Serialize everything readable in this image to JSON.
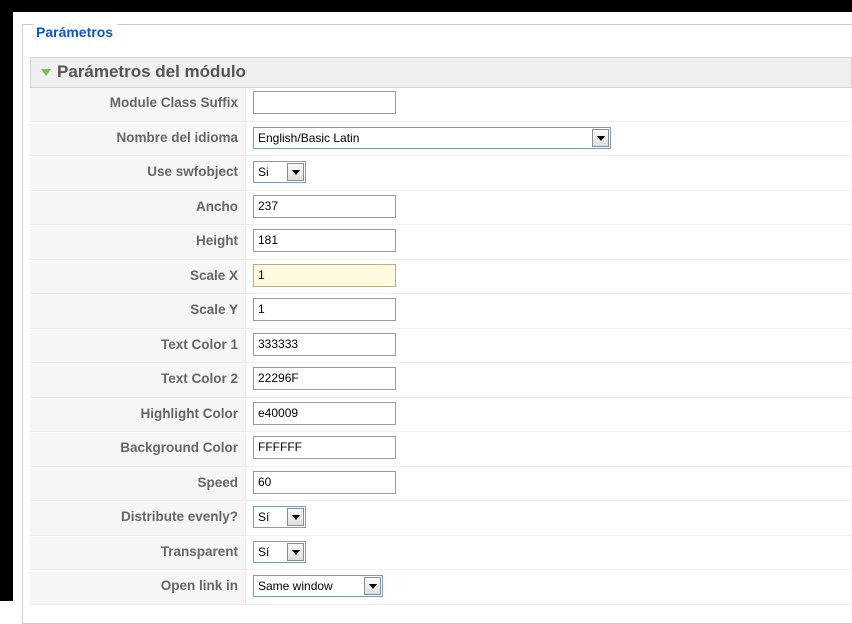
{
  "fieldset": {
    "legend": "Parámetros"
  },
  "panel": {
    "title": "Parámetros del módulo",
    "arrow_color": "#76c043"
  },
  "colors": {
    "legend": "#0b55c4",
    "label": "#666666",
    "focused_bg": "#fffadf"
  },
  "rows": [
    {
      "label": "Module Class Suffix",
      "value": "",
      "kind": "text"
    },
    {
      "label": "Nombre del idioma",
      "value": "English/Basic Latin",
      "kind": "select"
    },
    {
      "label": "Use swfobject",
      "value": "Si",
      "kind": "select"
    },
    {
      "label": "Ancho",
      "value": "237",
      "kind": "text"
    },
    {
      "label": "Height",
      "value": "181",
      "kind": "text"
    },
    {
      "label": "Scale X",
      "value": "1",
      "kind": "text",
      "focused": true
    },
    {
      "label": "Scale Y",
      "value": "1",
      "kind": "text"
    },
    {
      "label": "Text Color 1",
      "value": "333333",
      "kind": "text"
    },
    {
      "label": "Text Color 2",
      "value": "22296F",
      "kind": "text"
    },
    {
      "label": "Highlight Color",
      "value": "e40009",
      "kind": "text"
    },
    {
      "label": "Background Color",
      "value": "FFFFFF",
      "kind": "text"
    },
    {
      "label": "Speed",
      "value": "60",
      "kind": "text"
    },
    {
      "label": "Distribute evenly?",
      "value": "Sí",
      "kind": "select"
    },
    {
      "label": "Transparent",
      "value": "Sí",
      "kind": "select"
    },
    {
      "label": "Open link in",
      "value": "Same window",
      "kind": "select"
    }
  ]
}
